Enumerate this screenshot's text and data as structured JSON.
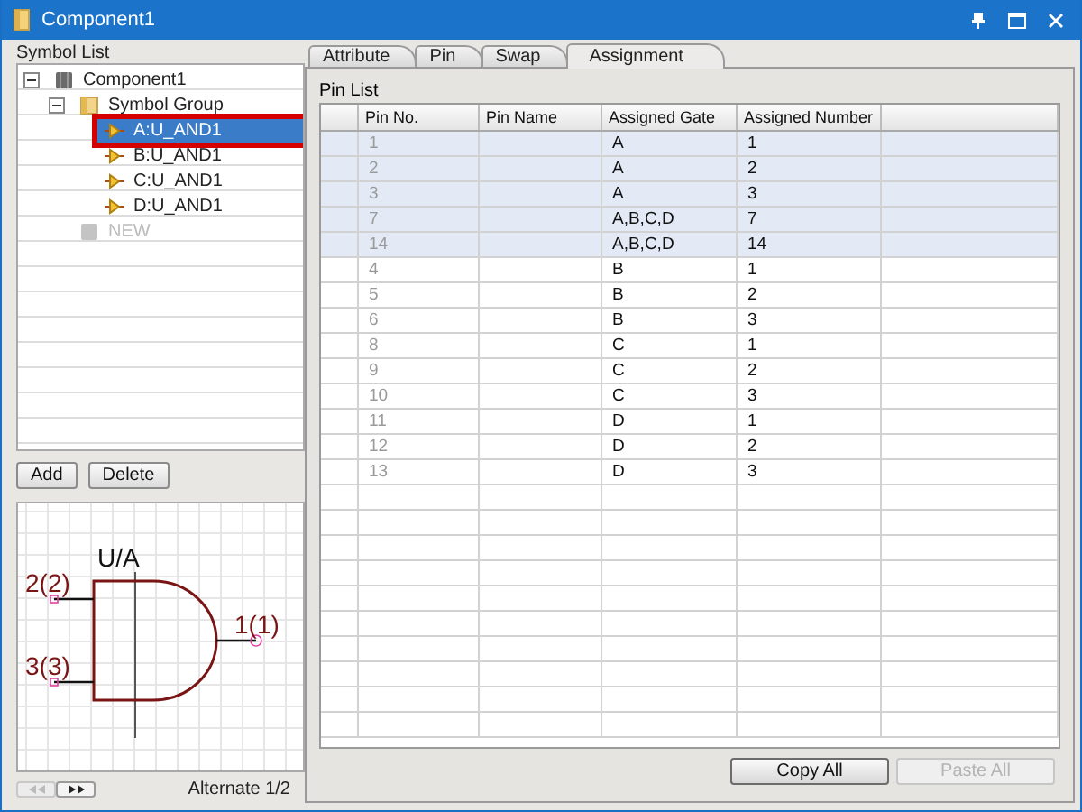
{
  "window": {
    "title": "Component1"
  },
  "symbol_list": {
    "label": "Symbol List",
    "tree": [
      {
        "label": "Component1",
        "kind": "component",
        "expanded": true,
        "selected": false,
        "annotated": false,
        "disabled": false,
        "children": [
          {
            "label": "Symbol Group",
            "kind": "group",
            "expanded": true,
            "selected": false,
            "annotated": false,
            "disabled": false,
            "children": [
              {
                "label": "A:U_AND1",
                "kind": "symbol",
                "selected": true,
                "annotated": true,
                "disabled": false
              },
              {
                "label": "B:U_AND1",
                "kind": "symbol",
                "selected": false,
                "annotated": false,
                "disabled": false
              },
              {
                "label": "C:U_AND1",
                "kind": "symbol",
                "selected": false,
                "annotated": false,
                "disabled": false
              },
              {
                "label": "D:U_AND1",
                "kind": "symbol",
                "selected": false,
                "annotated": false,
                "disabled": false
              }
            ]
          },
          {
            "label": "NEW",
            "kind": "new",
            "selected": false,
            "annotated": false,
            "disabled": true
          }
        ]
      }
    ],
    "buttons": [
      "Add",
      "Delete"
    ]
  },
  "preview": {
    "ref": "U/A",
    "pins": [
      "2(2)",
      "3(3)"
    ],
    "output_pin": "1(1)",
    "pager": [
      {
        "kind": "prev",
        "disabled": true
      },
      {
        "kind": "next",
        "disabled": false
      }
    ],
    "caption": "Alternate 1/2"
  },
  "tabs": [
    {
      "label": "Attribute",
      "selected": false
    },
    {
      "label": "Pin",
      "selected": false
    },
    {
      "label": "Swap",
      "selected": false
    },
    {
      "label": "Assignment",
      "selected": true
    }
  ],
  "pin_list": {
    "label": "Pin List",
    "columns": [
      "Pin No.",
      "Pin Name",
      "Assigned Gate",
      "Assigned Number"
    ],
    "rows": [
      {
        "cells": [
          "1",
          "",
          "A",
          "1"
        ],
        "selected": true
      },
      {
        "cells": [
          "2",
          "",
          "A",
          "2"
        ],
        "selected": true
      },
      {
        "cells": [
          "3",
          "",
          "A",
          "3"
        ],
        "selected": true
      },
      {
        "cells": [
          "7",
          "",
          "A,B,C,D",
          "7"
        ],
        "selected": true
      },
      {
        "cells": [
          "14",
          "",
          "A,B,C,D",
          "14"
        ],
        "selected": true
      },
      {
        "cells": [
          "4",
          "",
          "B",
          "1"
        ],
        "selected": false
      },
      {
        "cells": [
          "5",
          "",
          "B",
          "2"
        ],
        "selected": false
      },
      {
        "cells": [
          "6",
          "",
          "B",
          "3"
        ],
        "selected": false
      },
      {
        "cells": [
          "8",
          "",
          "C",
          "1"
        ],
        "selected": false
      },
      {
        "cells": [
          "9",
          "",
          "C",
          "2"
        ],
        "selected": false
      },
      {
        "cells": [
          "10",
          "",
          "C",
          "3"
        ],
        "selected": false
      },
      {
        "cells": [
          "11",
          "",
          "D",
          "1"
        ],
        "selected": false
      },
      {
        "cells": [
          "12",
          "",
          "D",
          "2"
        ],
        "selected": false
      },
      {
        "cells": [
          "13",
          "",
          "D",
          "3"
        ],
        "selected": false
      }
    ]
  },
  "actions": [
    {
      "label": "Copy All",
      "disabled": false
    },
    {
      "label": "Paste All",
      "disabled": true
    }
  ]
}
